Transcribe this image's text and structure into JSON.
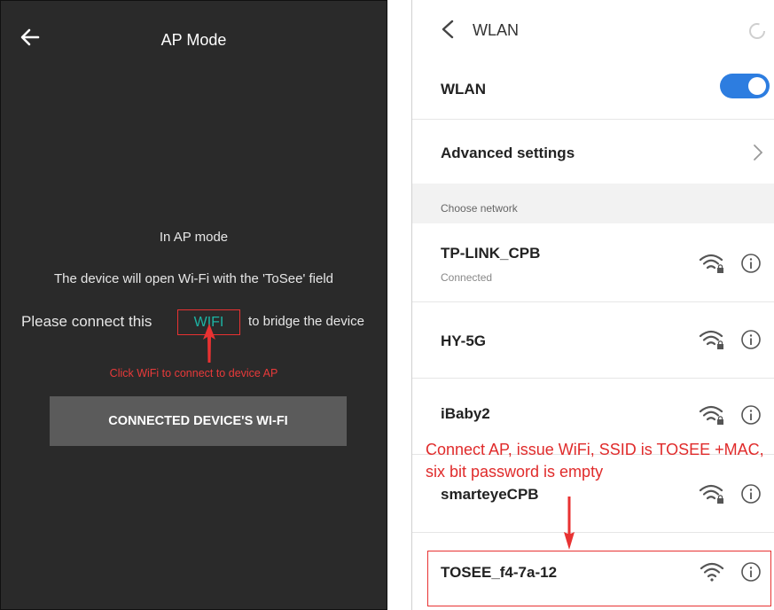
{
  "ap_mode": {
    "title": "AP Mode",
    "line1": "In AP mode",
    "line2": "The device will open Wi-Fi with the 'ToSee' field",
    "line3_pre": "Please connect this",
    "wifi_link": "WIFI",
    "line3_post": "to bridge the device",
    "hint": "Click WiFi to connect to device AP",
    "button_label": "CONNECTED DEVICE'S WI-FI"
  },
  "wlan": {
    "header_title": "WLAN",
    "toggle_label": "WLAN",
    "toggle_on": true,
    "advanced_label": "Advanced settings",
    "section_label": "Choose network",
    "networks": [
      {
        "ssid": "TP-LINK_CPB",
        "status": "Connected",
        "locked": true
      },
      {
        "ssid": "HY-5G",
        "status": "",
        "locked": true
      },
      {
        "ssid": "iBaby2",
        "status": "",
        "locked": true
      },
      {
        "ssid": "smarteyeCPB",
        "status": "",
        "locked": true
      },
      {
        "ssid": "TOSEE_f4-7a-12",
        "status": "",
        "locked": false
      }
    ],
    "annotation": "Connect AP, issue WiFi, SSID is TOSEE +MAC, six bit password is empty"
  },
  "colors": {
    "annotation_red": "#e83232",
    "wifi_link_teal": "#1db3a3",
    "toggle_blue": "#2d7de0",
    "dark_bg": "#2a2a2a"
  },
  "icons": [
    "back-arrow-icon",
    "chevron-left-icon",
    "loading-spinner-icon",
    "chevron-right-icon",
    "wifi-lock-icon",
    "wifi-icon",
    "info-icon"
  ]
}
